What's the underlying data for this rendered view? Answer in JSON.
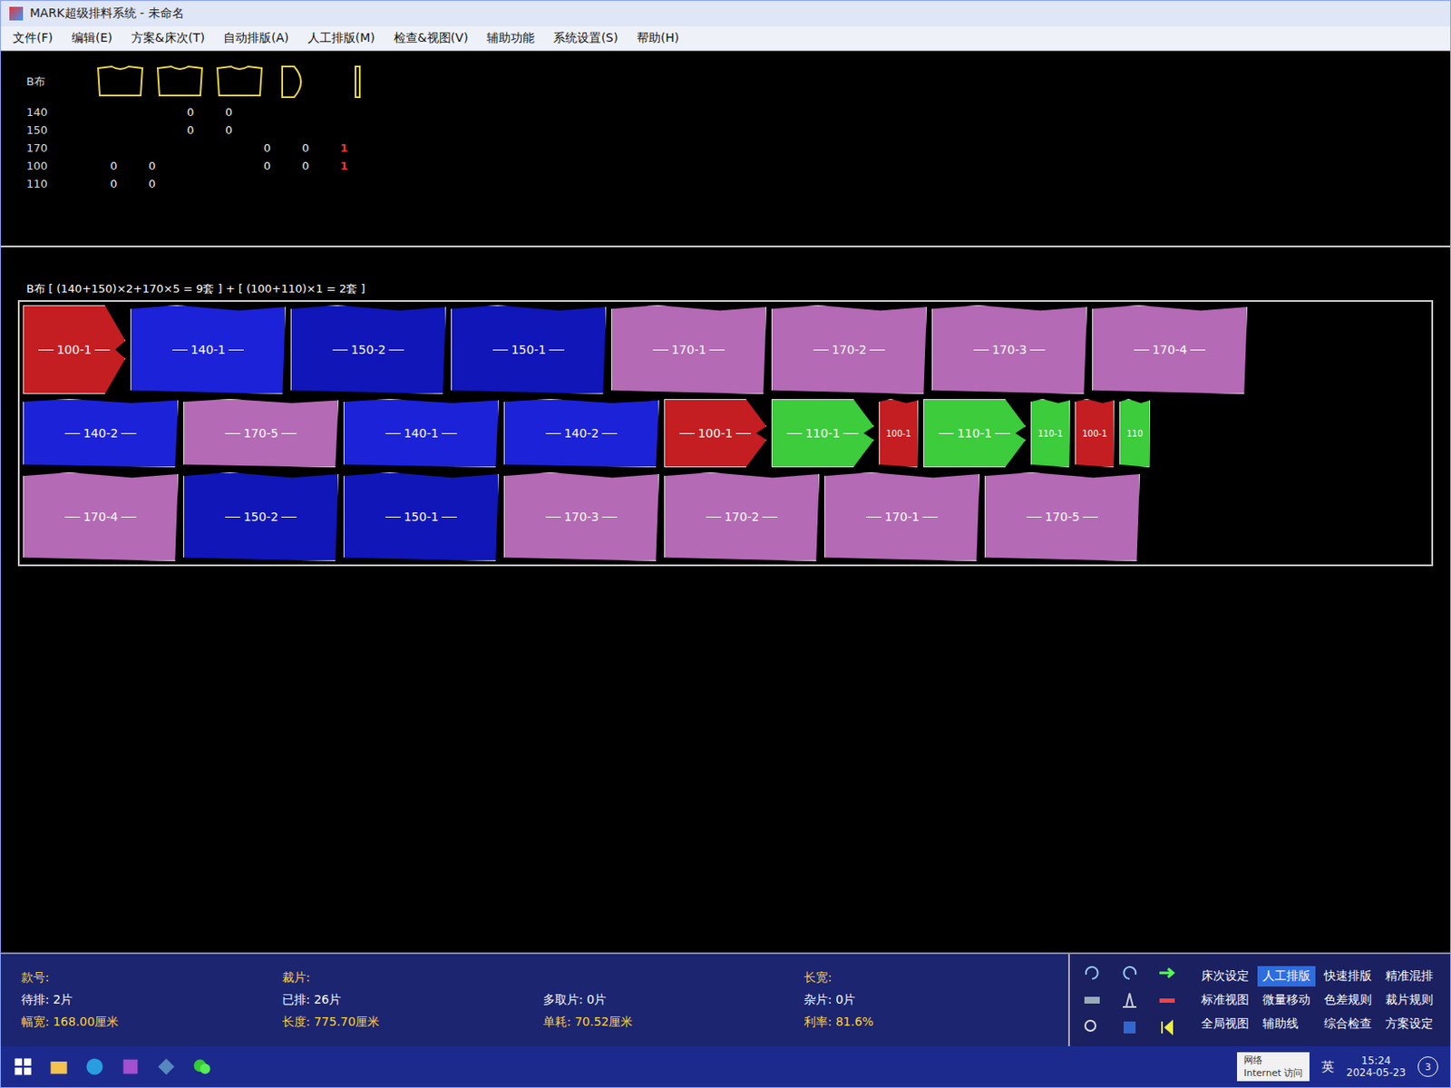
{
  "window": {
    "title": "MARK超级排料系统 - 未命名"
  },
  "menu": [
    "文件(F)",
    "编辑(E)",
    "方案&床次(T)",
    "自动排版(A)",
    "人工排版(M)",
    "检查&视图(V)",
    "辅助功能",
    "系统设置(S)",
    "帮助(H)"
  ],
  "piece_table": {
    "fabric": "B布",
    "rows": [
      {
        "size": "140",
        "cells": [
          {
            "text": "",
            "alert": false
          },
          {
            "text": "",
            "alert": false
          },
          {
            "text": "0",
            "alert": false
          },
          {
            "text": "0",
            "alert": false
          },
          {
            "text": "",
            "alert": false
          },
          {
            "text": "",
            "alert": false
          },
          {
            "text": "",
            "alert": false
          }
        ]
      },
      {
        "size": "150",
        "cells": [
          {
            "text": "",
            "alert": false
          },
          {
            "text": "",
            "alert": false
          },
          {
            "text": "0",
            "alert": false
          },
          {
            "text": "0",
            "alert": false
          },
          {
            "text": "",
            "alert": false
          },
          {
            "text": "",
            "alert": false
          },
          {
            "text": "",
            "alert": false
          }
        ]
      },
      {
        "size": "170",
        "cells": [
          {
            "text": "",
            "alert": false
          },
          {
            "text": "",
            "alert": false
          },
          {
            "text": "",
            "alert": false
          },
          {
            "text": "",
            "alert": false
          },
          {
            "text": "0",
            "alert": false
          },
          {
            "text": "0",
            "alert": false
          },
          {
            "text": "1",
            "alert": true
          }
        ]
      },
      {
        "size": "100",
        "cells": [
          {
            "text": "0",
            "alert": false
          },
          {
            "text": "0",
            "alert": false
          },
          {
            "text": "",
            "alert": false
          },
          {
            "text": "",
            "alert": false
          },
          {
            "text": "0",
            "alert": false
          },
          {
            "text": "0",
            "alert": false
          },
          {
            "text": "1",
            "alert": true
          }
        ]
      },
      {
        "size": "110",
        "cells": [
          {
            "text": "0",
            "alert": false
          },
          {
            "text": "0",
            "alert": false
          },
          {
            "text": "",
            "alert": false
          },
          {
            "text": "",
            "alert": false
          },
          {
            "text": "",
            "alert": false
          },
          {
            "text": "",
            "alert": false
          },
          {
            "text": "",
            "alert": false
          }
        ]
      }
    ]
  },
  "marker": {
    "header": "B布  [ (140+150)×2+170×5 = 9套 ] + [ (100+110)×1 = 2套 ]",
    "lanes": [
      [
        {
          "label": "100-1",
          "color": "#c41e22",
          "kind": "medium"
        },
        {
          "label": "140-1",
          "color": "#1c22d8",
          "kind": "large"
        },
        {
          "label": "150-2",
          "color": "#1016b8",
          "kind": "large"
        },
        {
          "label": "150-1",
          "color": "#1016b8",
          "kind": "large"
        },
        {
          "label": "170-1",
          "color": "#b46ab4",
          "kind": "large"
        },
        {
          "label": "170-2",
          "color": "#b46ab4",
          "kind": "large"
        },
        {
          "label": "170-3",
          "color": "#b46ab4",
          "kind": "large"
        },
        {
          "label": "170-4",
          "color": "#b46ab4",
          "kind": "large"
        }
      ],
      [
        {
          "label": "140-2",
          "color": "#1c22d8",
          "kind": "large"
        },
        {
          "label": "170-5",
          "color": "#b46ab4",
          "kind": "large"
        },
        {
          "label": "140-1",
          "color": "#1c22d8",
          "kind": "large"
        },
        {
          "label": "140-2",
          "color": "#1c22d8",
          "kind": "large"
        },
        {
          "label": "100-1",
          "color": "#c41e22",
          "kind": "medium"
        },
        {
          "label": "110-1",
          "color": "#3ccc3c",
          "kind": "medium"
        },
        {
          "label": "100-1",
          "color": "#c41e22",
          "kind": "small"
        },
        {
          "label": "110-1",
          "color": "#3ccc3c",
          "kind": "medium"
        },
        {
          "label": "110-1",
          "color": "#3ccc3c",
          "kind": "small"
        },
        {
          "label": "100-1",
          "color": "#c41e22",
          "kind": "small"
        },
        {
          "label": "110",
          "color": "#3ccc3c",
          "kind": "tiny"
        }
      ],
      [
        {
          "label": "170-4",
          "color": "#b46ab4",
          "kind": "large"
        },
        {
          "label": "150-2",
          "color": "#1016b8",
          "kind": "large"
        },
        {
          "label": "150-1",
          "color": "#1016b8",
          "kind": "large"
        },
        {
          "label": "170-3",
          "color": "#b46ab4",
          "kind": "large"
        },
        {
          "label": "170-2",
          "color": "#b46ab4",
          "kind": "large"
        },
        {
          "label": "170-1",
          "color": "#b46ab4",
          "kind": "large"
        },
        {
          "label": "170-5",
          "color": "#b46ab4",
          "kind": "large"
        }
      ]
    ]
  },
  "status": [
    {
      "text": "款号:",
      "highlight": true
    },
    {
      "text": "裁片:",
      "highlight": true
    },
    {
      "text": "",
      "highlight": false
    },
    {
      "text": "长宽:",
      "highlight": true
    },
    {
      "text": "待排: 2片",
      "highlight": false
    },
    {
      "text": "已排: 26片",
      "highlight": false
    },
    {
      "text": "多取片: 0片",
      "highlight": false
    },
    {
      "text": "杂片: 0片",
      "highlight": false
    },
    {
      "text": "幅宽: 168.00厘米",
      "highlight": true
    },
    {
      "text": "长度: 775.70厘米",
      "highlight": true
    },
    {
      "text": "单耗: 70.52厘米",
      "highlight": true
    },
    {
      "text": "利率: 81.6%",
      "highlight": true
    }
  ],
  "toolbar": [
    {
      "label": "床次设定",
      "selected": false
    },
    {
      "label": "人工排版",
      "selected": true
    },
    {
      "label": "快速排版",
      "selected": false
    },
    {
      "label": "精准混排",
      "selected": false
    },
    {
      "label": "标准视图",
      "selected": false
    },
    {
      "label": "微量移动",
      "selected": false
    },
    {
      "label": "色差规则",
      "selected": false
    },
    {
      "label": "裁片规则",
      "selected": false
    },
    {
      "label": "全局视图",
      "selected": false
    },
    {
      "label": "辅助线",
      "selected": false
    },
    {
      "label": "综合检查",
      "selected": false
    },
    {
      "label": "方案设定",
      "selected": false
    }
  ],
  "taskbar": {
    "network": "网络",
    "network_sub": "Internet 访问",
    "ime": "英",
    "time": "15:24",
    "date": "2024-05-23",
    "notifications": "3"
  }
}
